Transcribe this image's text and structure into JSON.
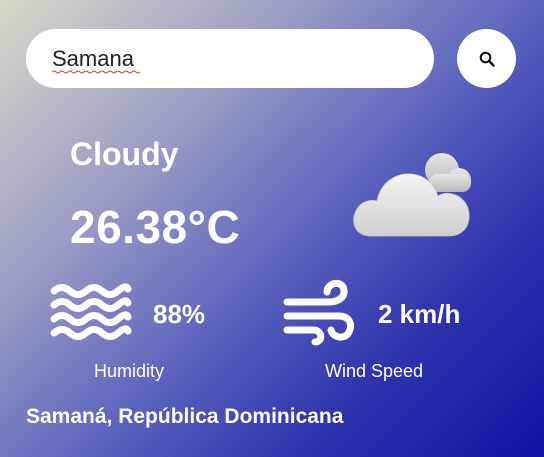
{
  "search": {
    "value": "Samana",
    "placeholder": "",
    "button_icon": "search-icon"
  },
  "weather": {
    "condition": "Cloudy",
    "temperature": "26.38°C",
    "icon": "cloud-icon"
  },
  "humidity": {
    "value": "88%",
    "label": "Humidity",
    "icon": "waves-icon"
  },
  "wind": {
    "value": "2 km/h",
    "label": "Wind Speed",
    "icon": "wind-icon"
  },
  "location": "Samaná, República Dominicana",
  "colors": {
    "gradient_start": "#d8d9c8",
    "gradient_end": "#0c13a3",
    "text": "#ffffff"
  }
}
